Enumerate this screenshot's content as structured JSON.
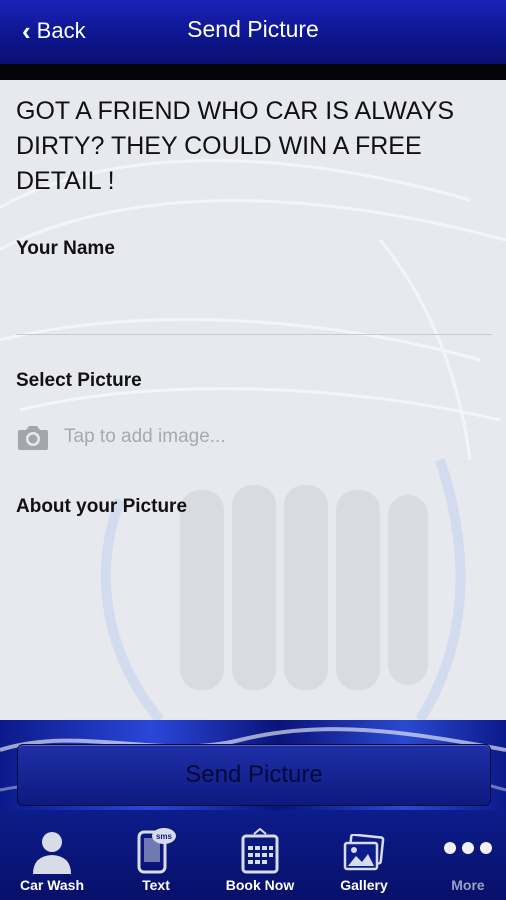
{
  "nav": {
    "back_label": "Back",
    "title": "Send Picture"
  },
  "form": {
    "headline": "GOT A FRIEND WHO CAR IS ALWAYS DIRTY? THEY COULD WIN A FREE DETAIL !",
    "name_label": "Your Name",
    "select_label": "Select Picture",
    "image_placeholder": "Tap to add image...",
    "about_label": "About your Picture",
    "submit_label": "Send Picture"
  },
  "tabs": [
    {
      "label": "Car Wash",
      "icon": "person-icon"
    },
    {
      "label": "Text",
      "icon": "sms-phone-icon"
    },
    {
      "label": "Book Now",
      "icon": "calendar-icon"
    },
    {
      "label": "Gallery",
      "icon": "gallery-icon"
    },
    {
      "label": "More",
      "icon": "more-dots-icon"
    }
  ],
  "colors": {
    "nav_blue": "#0d1690",
    "tab_blue": "#0c1c8a",
    "content_bg": "#e8e9ee"
  }
}
